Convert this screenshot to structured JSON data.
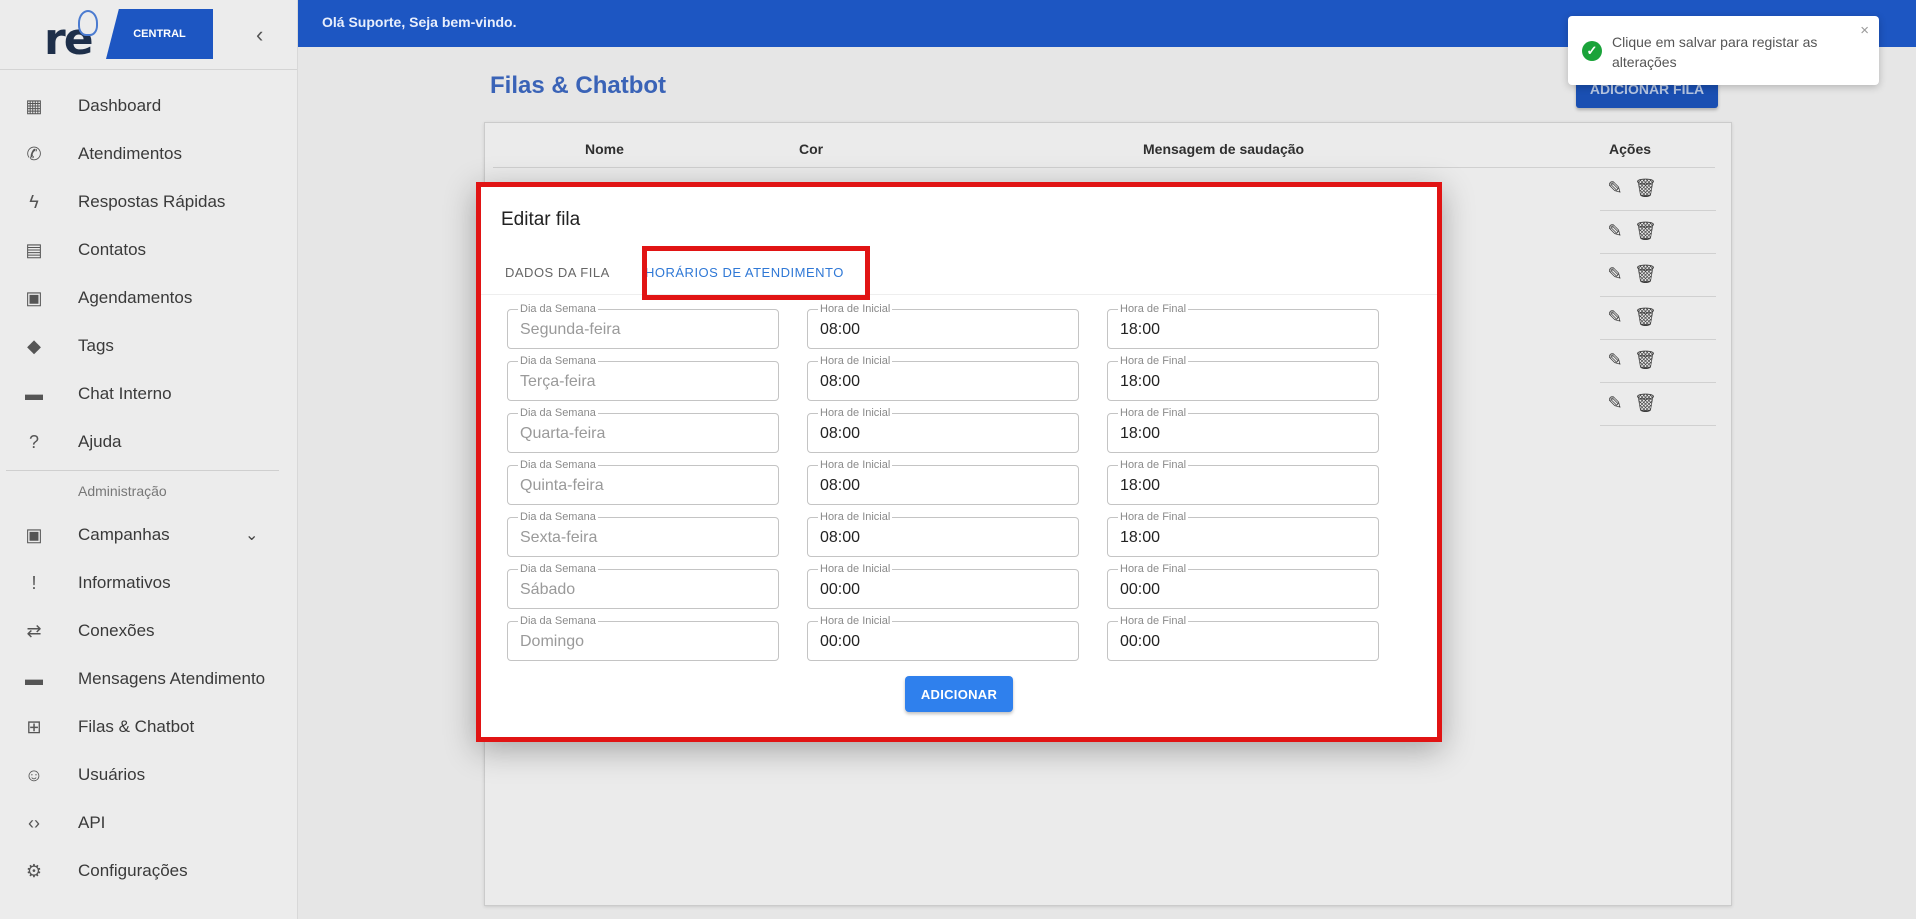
{
  "header": {
    "greeting": "Olá Suporte, Seja bem-vindo."
  },
  "logo": {
    "text": "re",
    "badge": "CENTRAL"
  },
  "sidebar": {
    "items": [
      {
        "label": "Dashboard",
        "icon": "dashboard-icon",
        "glyph": "▦"
      },
      {
        "label": "Atendimentos",
        "icon": "whatsapp-icon",
        "glyph": "✆"
      },
      {
        "label": "Respostas Rápidas",
        "icon": "flash-icon",
        "glyph": "ϟ"
      },
      {
        "label": "Contatos",
        "icon": "contact-card-icon",
        "glyph": "▤"
      },
      {
        "label": "Agendamentos",
        "icon": "calendar-icon",
        "glyph": "▣"
      },
      {
        "label": "Tags",
        "icon": "tag-icon",
        "glyph": "◆"
      },
      {
        "label": "Chat Interno",
        "icon": "chat-icon",
        "glyph": "▬"
      },
      {
        "label": "Ajuda",
        "icon": "help-icon",
        "glyph": "?"
      }
    ],
    "admin_section": "Administração",
    "admin_items": [
      {
        "label": "Campanhas",
        "icon": "campaign-icon",
        "glyph": "▣"
      },
      {
        "label": "Informativos",
        "icon": "announcement-icon",
        "glyph": "!"
      },
      {
        "label": "Conexões",
        "icon": "sync-arrows-icon",
        "glyph": "⇄"
      },
      {
        "label": "Mensagens Atendimento",
        "icon": "message-icon",
        "glyph": "▬"
      },
      {
        "label": "Filas & Chatbot",
        "icon": "tree-icon",
        "glyph": "⊞"
      },
      {
        "label": "Usuários",
        "icon": "users-icon",
        "glyph": "☺"
      },
      {
        "label": "API",
        "icon": "code-icon",
        "glyph": "‹›"
      },
      {
        "label": "Configurações",
        "icon": "gear-icon",
        "glyph": "⚙"
      }
    ]
  },
  "main": {
    "title": "Filas & Chatbot",
    "add_button": "ADICIONAR FILA",
    "columns": [
      "Nome",
      "Cor",
      "Mensagem de saudação",
      "Ações"
    ]
  },
  "dialog": {
    "title": "Editar fila",
    "tabs": [
      "DADOS DA FILA",
      "HORÁRIOS DE ATENDIMENTO"
    ],
    "label_day": "Dia da Semana",
    "label_start": "Hora de Inicial",
    "label_end": "Hora de Final",
    "schedule": [
      {
        "day": "Segunda-feira",
        "start": "08:00",
        "end": "18:00"
      },
      {
        "day": "Terça-feira",
        "start": "08:00",
        "end": "18:00"
      },
      {
        "day": "Quarta-feira",
        "start": "08:00",
        "end": "18:00"
      },
      {
        "day": "Quinta-feira",
        "start": "08:00",
        "end": "18:00"
      },
      {
        "day": "Sexta-feira",
        "start": "08:00",
        "end": "18:00"
      },
      {
        "day": "Sábado",
        "start": "00:00",
        "end": "00:00"
      },
      {
        "day": "Domingo",
        "start": "00:00",
        "end": "00:00"
      }
    ],
    "add_button": "ADICIONAR"
  },
  "toast": {
    "message": "Clique em salvar para registar as alterações",
    "close": "×"
  },
  "colors": {
    "primary": "#1d56c2",
    "highlight": "#e11414",
    "success": "#1aa33a",
    "tab_active": "#2f78d6"
  }
}
